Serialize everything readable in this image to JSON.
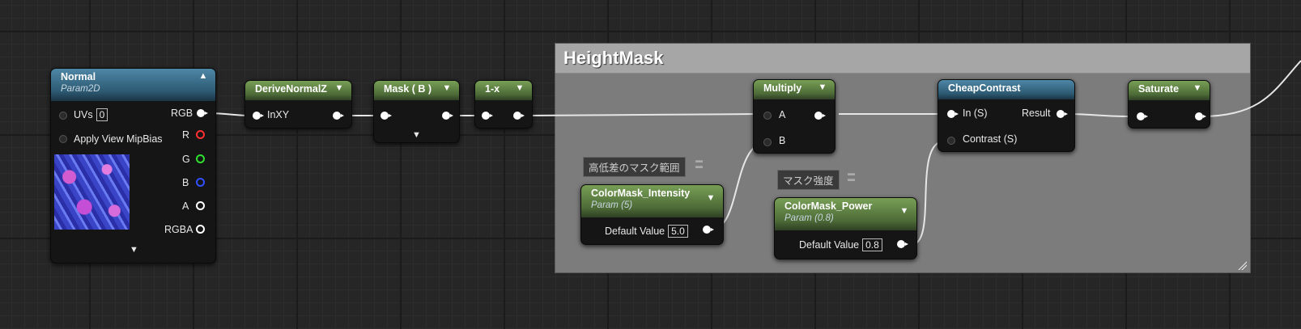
{
  "comment": {
    "title": "HeightMask"
  },
  "nodes": {
    "normal": {
      "title": "Normal",
      "subtitle": "Param2D",
      "uvs_label": "UVs",
      "uvs_value": "0",
      "mip_label": "Apply View MipBias",
      "outputs": [
        "RGB",
        "R",
        "G",
        "B",
        "A",
        "RGBA"
      ]
    },
    "derive": {
      "title": "DeriveNormalZ",
      "input": "InXY"
    },
    "mask": {
      "title": "Mask ( B )"
    },
    "oneminus": {
      "title": "1-x"
    },
    "multiply": {
      "title": "Multiply",
      "inputs": [
        "A",
        "B"
      ]
    },
    "cheap": {
      "title": "CheapContrast",
      "inputs": [
        "In (S)",
        "Contrast (S)"
      ],
      "output": "Result"
    },
    "saturate": {
      "title": "Saturate"
    },
    "intensity": {
      "title": "ColorMask_Intensity",
      "subtitle": "Param (5)",
      "label": "Default Value",
      "value": "5.0"
    },
    "power": {
      "title": "ColorMask_Power",
      "subtitle": "Param (0.8)",
      "label": "Default Value",
      "value": "0.8"
    }
  },
  "tags": {
    "intensity_group": "高低差のマスク範囲",
    "power_group": "マスク強度"
  },
  "colors": {
    "pin_r": "#ff3030",
    "pin_g": "#30e030",
    "pin_b": "#3050ff"
  },
  "icons": {
    "collapse": "chevron-up-icon",
    "expand": "chevron-down-icon"
  }
}
